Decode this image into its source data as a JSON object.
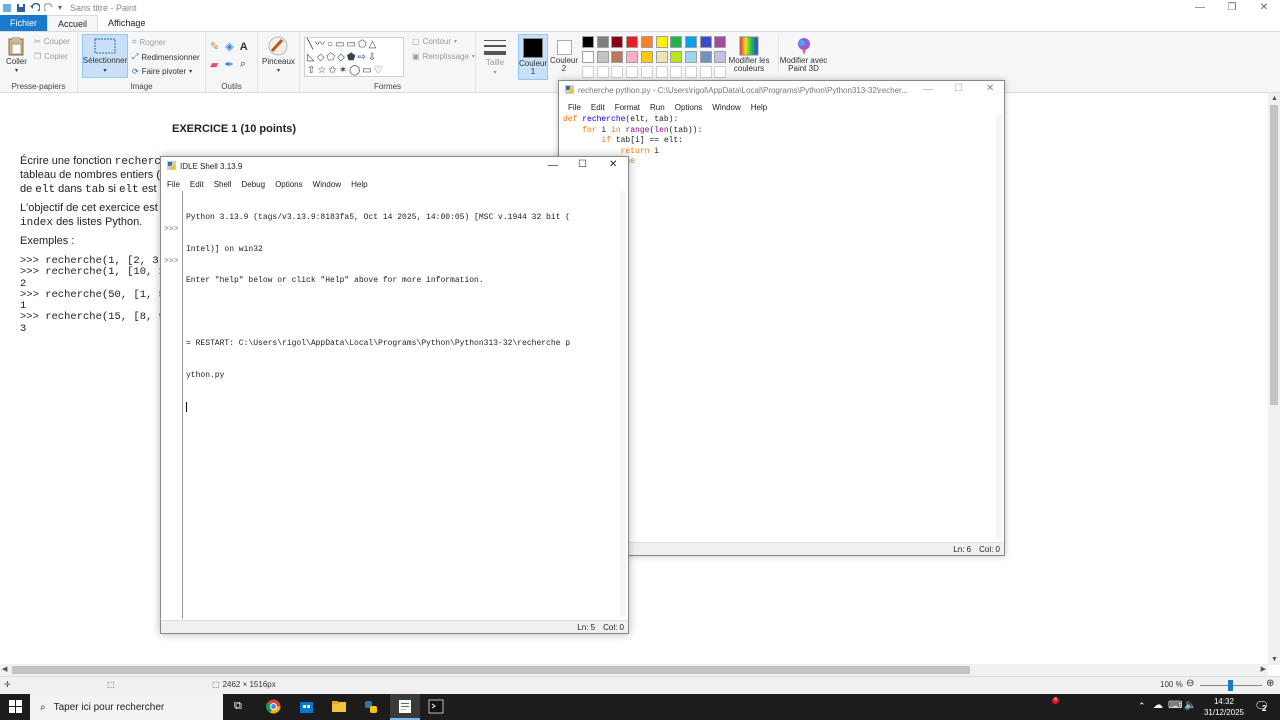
{
  "paint": {
    "title": "Sans titre - Paint",
    "tabs": [
      "Fichier",
      "Accueil",
      "Affichage"
    ],
    "clipboard": {
      "paste": "Coller",
      "cut": "Couper",
      "copy": "Copier",
      "label": "Presse-papiers"
    },
    "image": {
      "select": "Sélectionner",
      "crop": "Rogner",
      "resize": "Redimensionner",
      "rotate": "Faire pivoter",
      "label": "Image"
    },
    "tools": {
      "label": "Outils",
      "brushes": "Pinceaux"
    },
    "shapes": {
      "outline": "Contour",
      "fill": "Remplissage",
      "label": "Formes"
    },
    "size": "Taille",
    "color1": "Couleur 1",
    "color2": "Couleur 2",
    "edit_colors": "Modifier les couleurs",
    "paint3d": "Modifier avec Paint 3D",
    "palette": [
      "#000000",
      "#7f7f7f",
      "#880015",
      "#ed1c24",
      "#ff7f27",
      "#fff200",
      "#22b14c",
      "#00a2e8",
      "#3f48cc",
      "#a349a4",
      "#ffffff",
      "#c3c3c3",
      "#b97a57",
      "#ffaec9",
      "#ffc90e",
      "#efe4b0",
      "#b5e61d",
      "#99d9ea",
      "#7092be",
      "#c8bfe7"
    ],
    "status": {
      "dimensions": "2462 × 1516px",
      "zoom": "100 %"
    }
  },
  "document": {
    "heading": "EXERCICE 1 (10 points)",
    "lines": [
      {
        "a": "Écrire une fonction ",
        "b": "recherche"
      },
      {
        "a": "tableau de nombres entiers (t"
      },
      {
        "a": "de ",
        "b": "elt",
        "c": " dans ",
        "d": "tab",
        "e": " si ",
        "f": "elt",
        "g": " est d"
      },
      {
        "a": "L'objectif de cet exercice est c"
      },
      {
        "a": "",
        "b": "index",
        "c": " des listes Python."
      },
      {
        "a": "Exemples :"
      }
    ],
    "examples": [
      ">>> recherche(1, [2, 3",
      ">>> recherche(1, [10, 1",
      "2",
      ">>> recherche(50, [1, 5",
      "1",
      ">>> recherche(15, [8, 9",
      "3"
    ]
  },
  "editor": {
    "title": "recherche python.py - C:\\Users\\rigol\\AppData\\Local\\Programs\\Python\\Python313-32\\recher...",
    "menu": [
      "File",
      "Edit",
      "Format",
      "Run",
      "Options",
      "Window",
      "Help"
    ],
    "status": {
      "ln": "Ln: 6",
      "col": "Col: 0"
    }
  },
  "shell": {
    "title": "IDLE Shell 3.13.9",
    "menu": [
      "File",
      "Edit",
      "Shell",
      "Debug",
      "Options",
      "Window",
      "Help"
    ],
    "banner1": "Python 3.13.9 (tags/v3.13.9:8183fa5, Oct 14 2025, 14:00:05) [MSC v.1944 32 bit (",
    "banner2": "Intel)] on win32",
    "banner3": "Enter \"help\" below or click \"Help\" above for more information.",
    "restart1": "= RESTART: C:\\Users\\rigol\\AppData\\Local\\Programs\\Python\\Python313-32\\recherche p",
    "restart2": "ython.py",
    "prompt": ">>>",
    "status": {
      "ln": "Ln: 5",
      "col": "Col: 0"
    }
  },
  "taskbar": {
    "search_placeholder": "Taper ici pour rechercher",
    "time": "14:32",
    "date": "31/12/2025",
    "notifications": "2",
    "badge": "4"
  }
}
